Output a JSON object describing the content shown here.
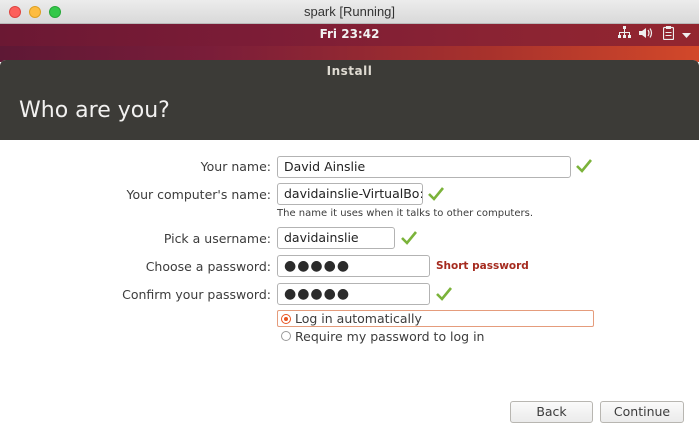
{
  "window": {
    "title": "spark [Running]"
  },
  "panel": {
    "clock": "Fri 23:42"
  },
  "installer": {
    "titlebar": "Install",
    "heading": "Who are you?",
    "fields": {
      "name_label": "Your name:",
      "name_value": "David Ainslie",
      "computer_label": "Your computer's name:",
      "computer_value": "davidainslie-VirtualBo:",
      "computer_hint": "The name it uses when it talks to other computers.",
      "username_label": "Pick a username:",
      "username_value": "davidainslie",
      "password_label": "Choose a password:",
      "password_value": "●●●●●",
      "password_strength": "Short password",
      "confirm_label": "Confirm your password:",
      "confirm_value": "●●●●●"
    },
    "login_options": {
      "auto": "Log in automatically",
      "require": "Require my password to log in",
      "selected": "auto"
    },
    "buttons": {
      "back": "Back",
      "continue": "Continue"
    }
  },
  "icons": {
    "check": "checkmark-icon",
    "network": "network-icon",
    "volume": "volume-icon",
    "clipboard": "clipboard-icon",
    "menu": "chevron-down-icon"
  },
  "colors": {
    "ubuntu_orange": "#e95420",
    "check_green": "#7bb33a",
    "warning_red": "#a52a1e"
  }
}
